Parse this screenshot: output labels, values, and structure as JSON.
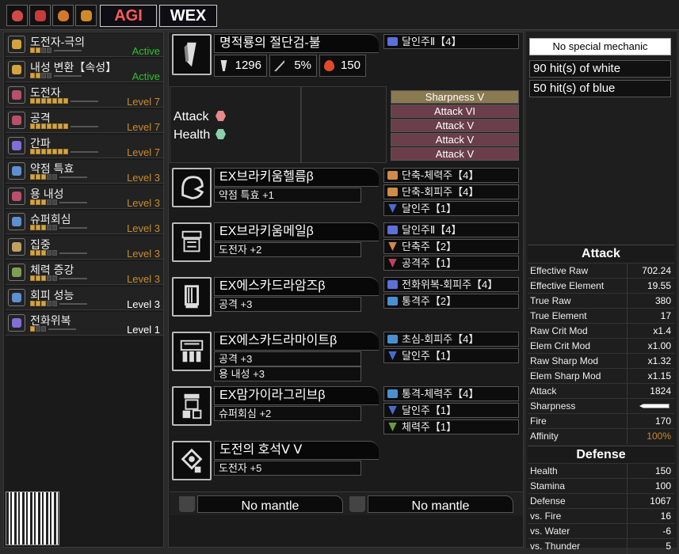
{
  "topbar": {
    "icons": [
      "fire-monster-icon-1",
      "fire-monster-icon-2",
      "fire-monster-icon-3",
      "fire-monster-icon-4"
    ],
    "agi_label": "AGI",
    "wex_label": "WEX",
    "agi_color": "#ff5a5a",
    "wex_color": "#ffffff"
  },
  "skills": [
    {
      "name": "도전자-극의",
      "level": "Active",
      "pips": 2,
      "max": 4,
      "color": "#d4a441",
      "status": "green"
    },
    {
      "name": "내성 변환【속성】",
      "level": "Active",
      "pips": 2,
      "max": 4,
      "color": "#d4a441",
      "status": "green"
    },
    {
      "name": "도전자",
      "level": "Level 7",
      "pips": 7,
      "max": 7,
      "color": "#b8506b",
      "status": "orange"
    },
    {
      "name": "공격",
      "level": "Level 7",
      "pips": 7,
      "max": 7,
      "color": "#b8506b",
      "status": "orange"
    },
    {
      "name": "간파",
      "level": "Level 7",
      "pips": 7,
      "max": 7,
      "color": "#7f6fd6",
      "status": "orange"
    },
    {
      "name": "약점 특효",
      "level": "Level 3",
      "pips": 3,
      "max": 5,
      "color": "#5e8fd0",
      "status": "orange"
    },
    {
      "name": "용 내성",
      "level": "Level 3",
      "pips": 3,
      "max": 5,
      "color": "#b8506b",
      "status": "orange"
    },
    {
      "name": "슈퍼회심",
      "level": "Level 3",
      "pips": 3,
      "max": 5,
      "color": "#5e8fd0",
      "status": "orange"
    },
    {
      "name": "집중",
      "level": "Level 3",
      "pips": 3,
      "max": 5,
      "color": "#c0a060",
      "status": "orange"
    },
    {
      "name": "체력 증강",
      "level": "Level 3",
      "pips": 3,
      "max": 5,
      "color": "#7ca050",
      "status": "orange"
    },
    {
      "name": "회피 성능",
      "level": "Level 3",
      "pips": 3,
      "max": 5,
      "color": "#5e8fd0",
      "status": "white"
    },
    {
      "name": "전화위복",
      "level": "Level 1",
      "pips": 1,
      "max": 3,
      "color": "#7f6fd6",
      "status": "white"
    }
  ],
  "weapon": {
    "name": "명적룡의 절단검-불",
    "attack": "1296",
    "affinity": "5%",
    "element": "150",
    "deco": "달인주Ⅱ【4】",
    "bonuses": {
      "attack_label": "Attack",
      "health_label": "Health"
    },
    "sharpness": [
      "Sharpness V",
      "Attack VI",
      "Attack V",
      "Attack V",
      "Attack V"
    ]
  },
  "armor": [
    {
      "name": "EX브라키움헬름β",
      "skills": [
        "약점 특효 +1"
      ],
      "decos": [
        {
          "label": "단축-체력주【4】",
          "color": "#d08a4a"
        },
        {
          "label": "단축-회피주【4】",
          "color": "#d08a4a"
        },
        {
          "label": "달인주【1】",
          "color": "#4a6ad0"
        }
      ]
    },
    {
      "name": "EX브라키움메일β",
      "skills": [
        "도전자 +2"
      ],
      "decos": [
        {
          "label": "달인주Ⅱ【4】",
          "color": "#5e6fd6"
        },
        {
          "label": "단축주【2】",
          "color": "#d08a4a"
        },
        {
          "label": "공격주【1】",
          "color": "#c04060"
        }
      ]
    },
    {
      "name": "EX에스카드라암즈β",
      "skills": [
        "공격 +3"
      ],
      "decos": [
        {
          "label": "전화위복-회피주【4】",
          "color": "#5e6fd6"
        },
        {
          "label": "통격주【2】",
          "color": "#4a90d0"
        }
      ]
    },
    {
      "name": "EX에스카드라마이트β",
      "skills": [
        "공격 +3",
        "용 내성 +3"
      ],
      "decos": [
        {
          "label": "초심-회피주【4】",
          "color": "#4a90d0"
        },
        {
          "label": "달인주【1】",
          "color": "#4a6ad0"
        }
      ]
    },
    {
      "name": "EX맘가이라그리브β",
      "skills": [
        "슈퍼회심 +2"
      ],
      "decos": [
        {
          "label": "통격-체력주【4】",
          "color": "#4a90d0"
        },
        {
          "label": "달인주【1】",
          "color": "#4a6ad0"
        },
        {
          "label": "체력주【1】",
          "color": "#6a9a40"
        }
      ]
    },
    {
      "name": "도전의 호석Ⅴ Ⅴ",
      "skills": [
        "도전자 +5"
      ],
      "decos": []
    }
  ],
  "mantles": [
    "No mantle",
    "No mantle"
  ],
  "right": {
    "mechanic": "No special mechanic",
    "white_hits": "90 hit(s) of white",
    "blue_hits": "50 hit(s) of blue"
  },
  "attack_stats": {
    "title": "Attack",
    "rows": [
      [
        "Effective Raw",
        "702.24"
      ],
      [
        "Effective Element",
        "19.55"
      ],
      [
        "True Raw",
        "380"
      ],
      [
        "True Element",
        "17"
      ],
      [
        "Raw Crit Mod",
        "x1.4"
      ],
      [
        "Elem Crit Mod",
        "x1.00"
      ],
      [
        "Raw Sharp Mod",
        "x1.32"
      ],
      [
        "Elem Sharp Mod",
        "x1.15"
      ],
      [
        "Attack",
        "1824"
      ],
      [
        "Sharpness",
        ""
      ],
      [
        "Fire",
        "170"
      ],
      [
        "Affinity",
        "100%"
      ]
    ]
  },
  "defense_stats": {
    "title": "Defense",
    "rows": [
      [
        "Health",
        "150"
      ],
      [
        "Stamina",
        "100"
      ],
      [
        "Defense",
        "1067"
      ],
      [
        "vs. Fire",
        "16"
      ],
      [
        "vs. Water",
        "-6"
      ],
      [
        "vs. Thunder",
        "5"
      ]
    ]
  }
}
